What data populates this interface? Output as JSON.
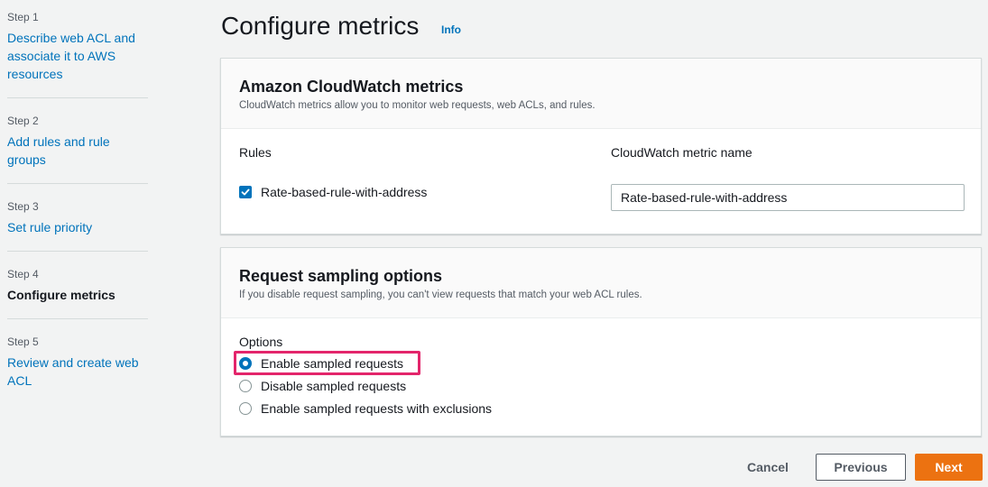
{
  "steps": [
    {
      "num": "Step 1",
      "label": "Describe web ACL and associate it to AWS resources",
      "current": false
    },
    {
      "num": "Step 2",
      "label": "Add rules and rule groups",
      "current": false
    },
    {
      "num": "Step 3",
      "label": "Set rule priority",
      "current": false
    },
    {
      "num": "Step 4",
      "label": "Configure metrics",
      "current": true
    },
    {
      "num": "Step 5",
      "label": "Review and create web ACL",
      "current": false
    }
  ],
  "header": {
    "title": "Configure metrics",
    "info": "Info"
  },
  "cloudwatch": {
    "title": "Amazon CloudWatch metrics",
    "description": "CloudWatch metrics allow you to monitor web requests, web ACLs, and rules.",
    "col_rules": "Rules",
    "col_metric": "CloudWatch metric name",
    "rule": {
      "label": "Rate-based-rule-with-address",
      "checked": true,
      "metric_value": "Rate-based-rule-with-address"
    }
  },
  "sampling": {
    "title": "Request sampling options",
    "description": "If you disable request sampling, you can't view requests that match your web ACL rules.",
    "options_label": "Options",
    "options": [
      {
        "label": "Enable sampled requests",
        "selected": true
      },
      {
        "label": "Disable sampled requests",
        "selected": false
      },
      {
        "label": "Enable sampled requests with exclusions",
        "selected": false
      }
    ]
  },
  "footer": {
    "cancel": "Cancel",
    "previous": "Previous",
    "next": "Next"
  },
  "colors": {
    "link": "#0073bb",
    "primary_button": "#ec7211",
    "highlight": "#e3256b"
  }
}
